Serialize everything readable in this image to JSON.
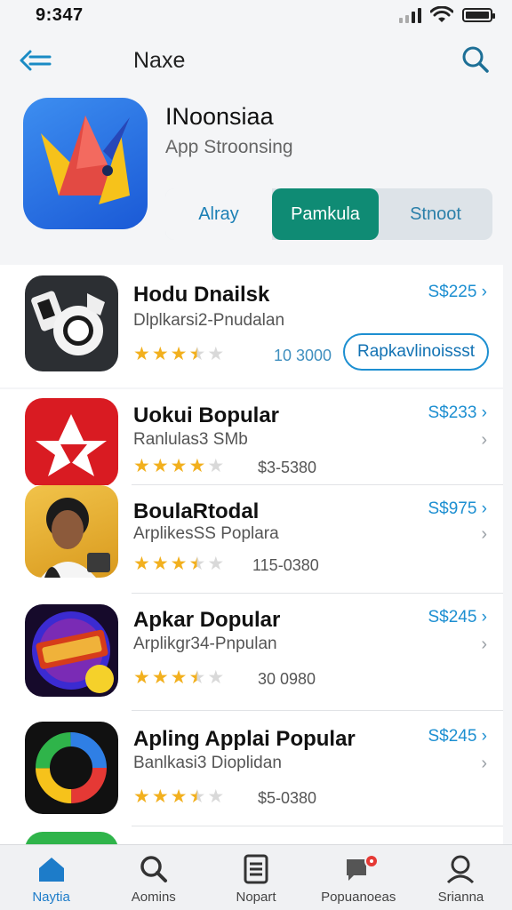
{
  "status": {
    "time": "9:347"
  },
  "nav": {
    "title": "Naxe"
  },
  "hero": {
    "name": "INoonsiaa",
    "subtitle": "App Stroonsing",
    "segments": [
      "Alray",
      "Pamkula",
      "Stnoot"
    ],
    "active_segment": "Pamkula"
  },
  "apps": [
    {
      "title": "Hodu Dnailsk",
      "subtitle": "Dlplkarsi2-Pnudalan",
      "rating": 3.5,
      "count": "10 3000",
      "price": "S$225 ›",
      "action": "Rapkavlinoissst"
    },
    {
      "title": "Uokui Bopular",
      "subtitle": "Ranlulas3 SMb",
      "rating": 4,
      "count": "$3-5380",
      "price": "S$233 ›"
    },
    {
      "title": "BoulaRtodal",
      "subtitle": "ArplikesSS  Poplara",
      "rating": 3.5,
      "count": "115-0380",
      "price": "S$975 ›"
    },
    {
      "title": "Apkar Dopular",
      "subtitle": "Arplikgr34-Pnpulan",
      "rating": 3.5,
      "count": "30 0980",
      "price": "S$245 ›"
    },
    {
      "title": "Apling Applai Popular",
      "subtitle": "Banlkasi3 Dioplidan",
      "rating": 3.5,
      "count": "$5-0380",
      "price": "S$245 ›"
    }
  ],
  "tabs": [
    {
      "label": "Naytia",
      "icon": "home-icon"
    },
    {
      "label": "Aomins",
      "icon": "search-icon"
    },
    {
      "label": "Nopart",
      "icon": "document-icon"
    },
    {
      "label": "Popuanoeas",
      "icon": "inbox-icon"
    },
    {
      "label": "Srianna",
      "icon": "profile-icon"
    }
  ],
  "colors": {
    "accent": "#1d8fd1",
    "active_segment": "#0f8b74",
    "star": "#f2b01e"
  }
}
